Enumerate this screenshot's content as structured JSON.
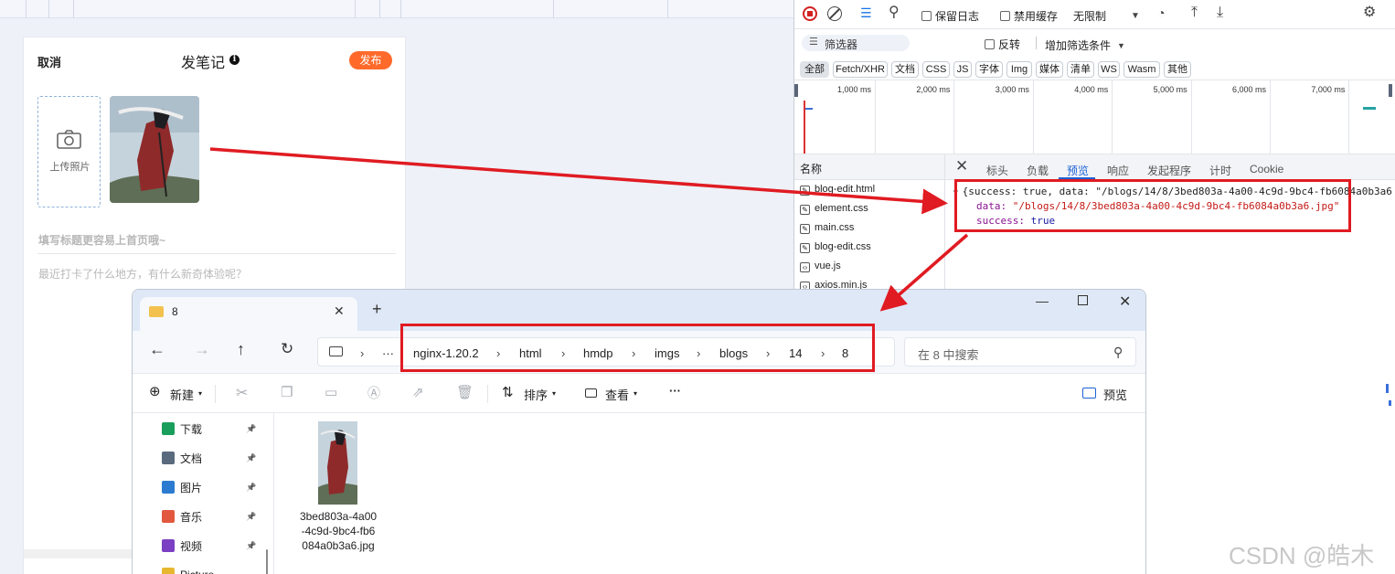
{
  "blog_editor": {
    "cancel": "取消",
    "title": "发笔记",
    "info_icon": "i",
    "publish": "发布",
    "upload_label": "上传照片",
    "title_placeholder": "填写标题更容易上首页哦~",
    "content_placeholder": "最近打卡了什么地方，有什么新奇体验呢？"
  },
  "devtools": {
    "toolbar": {
      "preserve_log": "保留日志",
      "disable_cache": "禁用缓存",
      "throttle": "无限制"
    },
    "filter": {
      "placeholder": "筛选器",
      "invert": "反转",
      "more_filters": "增加筛选条件"
    },
    "type_chips": [
      "全部",
      "Fetch/XHR",
      "文档",
      "CSS",
      "JS",
      "字体",
      "Img",
      "媒体",
      "清单",
      "WS",
      "Wasm",
      "其他"
    ],
    "timeline_ticks": [
      "1,000 ms",
      "2,000 ms",
      "3,000 ms",
      "4,000 ms",
      "5,000 ms",
      "6,000 ms",
      "7,000 ms"
    ],
    "name_header": "名称",
    "files": [
      "blog-edit.html",
      "element.css",
      "main.css",
      "blog-edit.css",
      "vue.js",
      "axios.min.js"
    ],
    "detail_tabs": [
      "标头",
      "负载",
      "预览",
      "响应",
      "发起程序",
      "计时",
      "Cookie"
    ],
    "active_tab": "预览",
    "preview": {
      "summary": "{success: true, data: \"/blogs/14/8/3bed803a-4a00-4c9d-9bc4-fb6084a0b3a6",
      "data_key": "data:",
      "data_value": "\"/blogs/14/8/3bed803a-4a00-4c9d-9bc4-fb6084a0b3a6.jpg\"",
      "success_key": "success:",
      "success_value": "true"
    }
  },
  "explorer": {
    "tab_title": "8",
    "breadcrumb": [
      "nginx-1.20.2",
      "html",
      "hmdp",
      "imgs",
      "blogs",
      "14",
      "8"
    ],
    "ellipsis": "···",
    "search_placeholder": "在 8 中搜索",
    "commands": {
      "new": "新建",
      "sort": "排序",
      "view": "查看",
      "more": "···",
      "preview": "预览"
    },
    "sidebar": [
      {
        "label": "下载",
        "color": "#1a9e5c"
      },
      {
        "label": "文档",
        "color": "#5a6a7e"
      },
      {
        "label": "图片",
        "color": "#2b7bd0"
      },
      {
        "label": "音乐",
        "color": "#e2583e"
      },
      {
        "label": "视频",
        "color": "#7a3fc2"
      },
      {
        "label": "Picture",
        "color": "#e8b730"
      }
    ],
    "file": {
      "name_line1": "3bed803a-4a00",
      "name_line2": "-4c9d-9bc4-fb6",
      "name_line3": "084a0b3a6.jpg"
    }
  },
  "watermark": "CSDN @皓木"
}
